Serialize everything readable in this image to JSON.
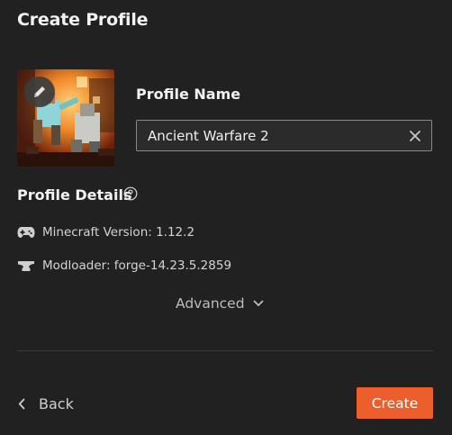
{
  "header": {
    "title": "Create Profile"
  },
  "profile_image": {
    "icon": "edit-pencil-icon"
  },
  "profile_name": {
    "label": "Profile Name",
    "value": "Ancient Warfare 2",
    "clear_icon": "close-icon"
  },
  "profile_details": {
    "label": "Profile Details",
    "help_icon": "help-circle-icon",
    "items": [
      {
        "icon": "gamepad-icon",
        "text": "Minecraft Version: 1.12.2"
      },
      {
        "icon": "anvil-icon",
        "text": "Modloader: forge-14.23.5.2859"
      }
    ]
  },
  "advanced": {
    "label": "Advanced",
    "icon": "chevron-down-icon"
  },
  "footer": {
    "back_label": "Back",
    "create_label": "Create"
  },
  "colors": {
    "background": "#212121",
    "accent": "#ec5f2c",
    "field_border": "#8a8a8a"
  }
}
